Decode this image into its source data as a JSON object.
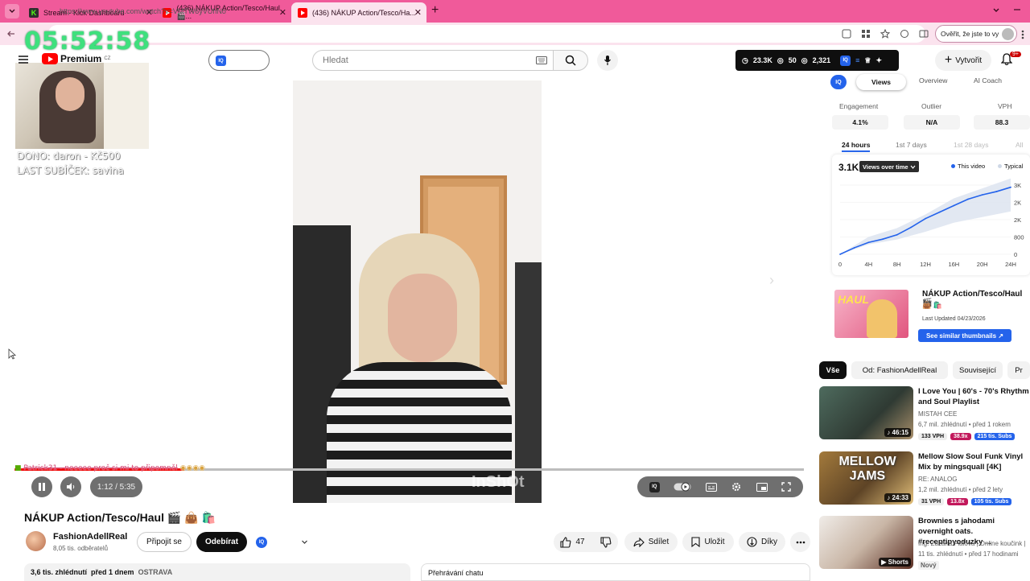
{
  "browser": {
    "tabs": [
      {
        "label": "Stream - Kick Dashboard"
      },
      {
        "label": "(436) NÁKUP Action/Tesco/Haul 🎬..."
      },
      {
        "label": "(436) NÁKUP Action/Tesco/Ha..."
      }
    ],
    "url": "https://www.youtube.com/watch?v=VMTW6yVUhNo",
    "verify_label": "Ověřit, že jste to vy"
  },
  "overlay": {
    "clock": "05:52:58",
    "dono": "DONO: daron - Kč500",
    "last_sub": "LAST SUBÍČEK: savina",
    "ticker": "Patrick31 - neeeee proč si mi to připomněl"
  },
  "header": {
    "logo": "Premium",
    "logo_region": "CZ",
    "search_placeholder": "Hledat",
    "stats": {
      "views": "23.3K",
      "likes": "50",
      "comments": "2,321"
    },
    "create_label": "Vytvořit",
    "notifications": "9+"
  },
  "player": {
    "time": "1:12 / 5:35",
    "progress": 0.215,
    "watermark": "InShOt"
  },
  "video": {
    "title": "NÁKUP Action/Tesco/Haul 🎬 👜 🛍️",
    "channel": "FashionAdellReal",
    "subs": "8,05 tis. odběratelů",
    "join_label": "Připojit se",
    "subscribe_label": "Odebírat",
    "likes": "47",
    "share_label": "Sdílet",
    "save_label": "Uložit",
    "thanks_label": "Díky",
    "meta_views": "3,6 tis. zhlédnutí",
    "meta_date": "před 1 dnem",
    "meta_location": "OSTRAVA",
    "chat_replay": "Přehrávání chatu"
  },
  "iq_panel": {
    "tabs": [
      "Views",
      "Overview",
      "AI Coach"
    ],
    "metrics": [
      {
        "label": "Engagement",
        "value": "4.1%"
      },
      {
        "label": "Outlier",
        "value": "N/A"
      },
      {
        "label": "VPH",
        "value": "88.3"
      }
    ],
    "ranges": [
      "24 hours",
      "1st 7 days",
      "1st 28 days",
      "All"
    ],
    "total_views": "3.1K",
    "dropdown": "Views over time",
    "legend": [
      "This video",
      "Typical"
    ],
    "thumb_title": "NÁKUP Action/Tesco/Haul 🎬",
    "thumb_emoji": "👜 🛍️",
    "thumb_updated": "Last Updated 04/23/2026",
    "thumb_button": "See similar thumbnails ↗",
    "thumb_word": "HAUL"
  },
  "chart_data": {
    "type": "area",
    "x_ticks": [
      "0",
      "4H",
      "8H",
      "12H",
      "16H",
      "20H",
      "24H"
    ],
    "y_ticks": [
      "3K",
      "2K",
      "2K",
      "800",
      "0"
    ],
    "ylim": [
      0,
      3200
    ],
    "series": [
      {
        "name": "This video",
        "x": [
          0,
          2,
          4,
          6,
          8,
          10,
          12,
          14,
          16,
          18,
          20,
          22,
          24
        ],
        "values": [
          0,
          300,
          550,
          700,
          900,
          1250,
          1650,
          1950,
          2250,
          2550,
          2750,
          2900,
          3100
        ]
      },
      {
        "name": "Typical",
        "x": [
          0,
          4,
          8,
          12,
          16,
          20,
          24
        ],
        "values": [
          0,
          700,
          1050,
          1600,
          2250,
          2650,
          3050
        ]
      }
    ]
  },
  "recommended": {
    "chips": [
      "Vše",
      "Od: FashionAdellReal",
      "Související",
      "Pr"
    ],
    "items": [
      {
        "title": "I Love You | 60's - 70's Rhythm and Soul Playlist",
        "channel": "MISTAH CEE",
        "meta": "6,7 mil. zhlédnutí • před 1 rokem",
        "duration": "46:15",
        "vph": "133 VPH",
        "outlier": "38.9x",
        "subs": "215 tis. Subs",
        "thumb_text": ""
      },
      {
        "title": "Mellow Slow Soul Funk Vinyl Mix by mingsquall [4K]",
        "channel": "RE: ANALOG",
        "meta": "1,2 mil. zhlédnutí • před 2 lety",
        "duration": "24:33",
        "vph": "31 VPH",
        "outlier": "13.8x",
        "subs": "105 tis. Subs",
        "thumb_text": "MELLOW JAMS"
      },
      {
        "title": "Brownies s jahodami overnight oats. #receptipyoduzky ...",
        "channel": "Ing. Zuzana Fialová | Online koučink |",
        "meta": "11 tis. zhlédnutí • před 17 hodinami",
        "duration": "Shorts",
        "new": "Nový",
        "thumb_text": ""
      }
    ]
  },
  "colors": {
    "accent_pink": "#f05a9a",
    "yt_red": "#ff0000",
    "iq_blue": "#2463eb",
    "clock_green": "#3ee07d"
  }
}
